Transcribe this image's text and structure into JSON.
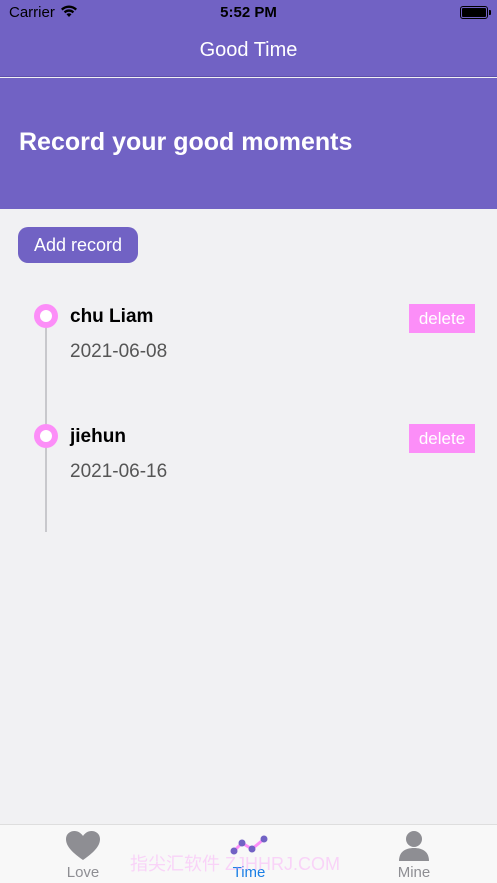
{
  "status_bar": {
    "carrier": "Carrier",
    "time": "5:52 PM"
  },
  "nav": {
    "title": "Good Time"
  },
  "banner": {
    "title": "Record your good moments"
  },
  "actions": {
    "add_record_label": "Add record"
  },
  "records": [
    {
      "title": "chu Liam",
      "date": "2021-06-08",
      "delete_label": "delete"
    },
    {
      "title": "jiehun",
      "date": "2021-06-16",
      "delete_label": "delete"
    }
  ],
  "tabs": [
    {
      "label": "Love",
      "icon": "heart-icon",
      "active": false
    },
    {
      "label": "Time",
      "icon": "timeline-icon",
      "active": true
    },
    {
      "label": "Mine",
      "icon": "person-icon",
      "active": false
    }
  ],
  "watermark": "指尖汇软件 ZJHHRJ.COM",
  "colors": {
    "primary": "#7162c4",
    "accent": "#fc8ef8",
    "active_tab": "#1a7fe5",
    "background": "#f1f1f3"
  }
}
